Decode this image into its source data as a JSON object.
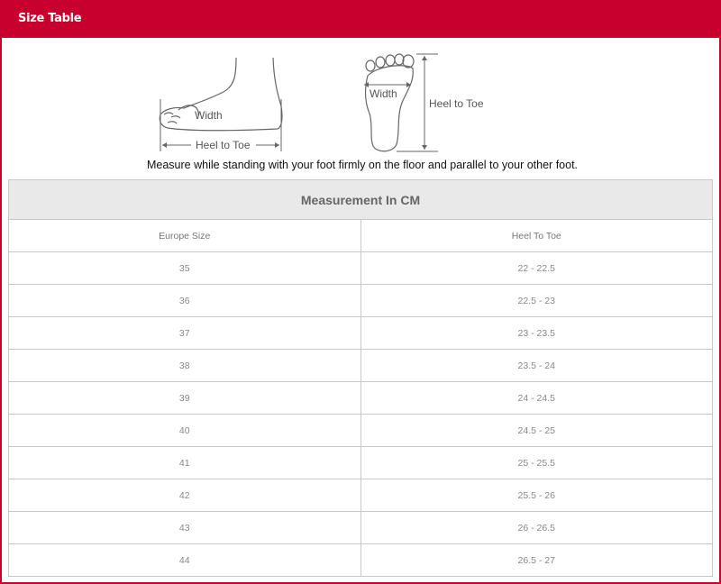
{
  "header": {
    "title": "Size Table",
    "color": "#c8002d"
  },
  "diagram": {
    "side_view": {
      "width_label": "Width",
      "length_label": "Heel to Toe"
    },
    "sole_view": {
      "width_label": "Width",
      "length_label": "Heel to Toe"
    }
  },
  "instruction": "Measure while standing with your foot firmly on the floor and parallel to your other foot.",
  "table": {
    "caption": "Measurement In CM",
    "columns": [
      "Europe Size",
      "Heel To Toe"
    ],
    "rows": [
      [
        "35",
        "22 - 22.5"
      ],
      [
        "36",
        "22.5 - 23"
      ],
      [
        "37",
        "23 - 23.5"
      ],
      [
        "38",
        "23.5 - 24"
      ],
      [
        "39",
        "24 - 24.5"
      ],
      [
        "40",
        "24.5 - 25"
      ],
      [
        "41",
        "25 - 25.5"
      ],
      [
        "42",
        "25.5 - 26"
      ],
      [
        "43",
        "26 - 26.5"
      ],
      [
        "44",
        "26.5 - 27"
      ]
    ]
  }
}
